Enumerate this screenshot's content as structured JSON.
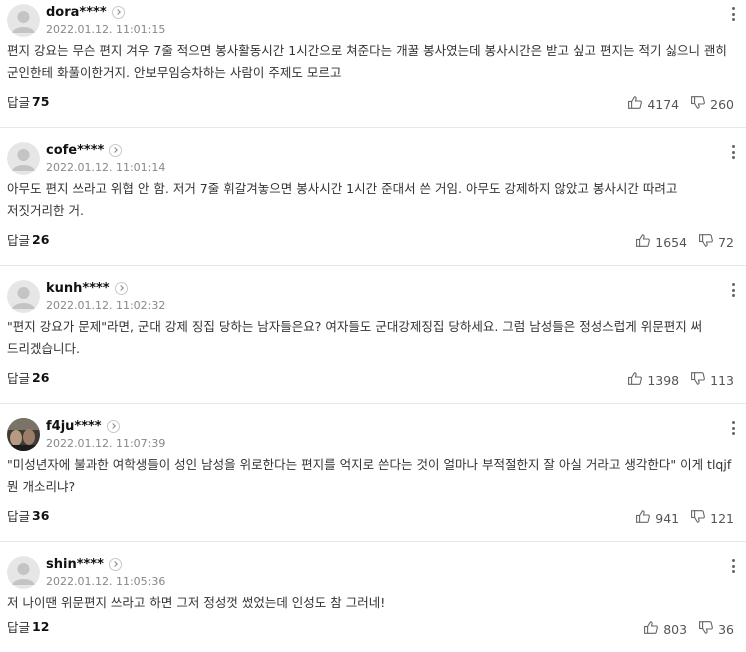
{
  "reply_label": "답글",
  "comments": [
    {
      "nickname": "dora****",
      "date": "2022.01.12. 11:01:15",
      "text": "편지 강요는 무슨 편지 겨우 7줄 적으면 봉사활동시간 1시간으로 쳐준다는 개꿀 봉사였는데 봉사시간은 받고 싶고 편지는 적기 싫으니 괜히 군인한테 화풀이한거지. 안보무임승차하는 사람이 주제도 모르고",
      "replies": "75",
      "likes": "4174",
      "dislikes": "260",
      "avatar": "default"
    },
    {
      "nickname": "cofe****",
      "date": "2022.01.12. 11:01:14",
      "text": "아무도 편지 쓰라고 위협 안 함. 저거 7줄 휘갈겨놓으면 봉사시간 1시간 준대서 쓴 거임. 아무도 강제하지 않았고 봉사시간 따려고 저짓거리한 거.",
      "replies": "26",
      "likes": "1654",
      "dislikes": "72",
      "avatar": "default"
    },
    {
      "nickname": "kunh****",
      "date": "2022.01.12. 11:02:32",
      "text": "\"편지 강요가 문제\"라면, 군대 강제 징집 당하는 남자들은요? 여자들도 군대강제징집 당하세요. 그럼 남성들은 정성스럽게 위문편지 써 드리겠습니다.",
      "replies": "26",
      "likes": "1398",
      "dislikes": "113",
      "avatar": "default"
    },
    {
      "nickname": "f4ju****",
      "date": "2022.01.12. 11:07:39",
      "text": "\"미성년자에 불과한 여학생들이 성인 남성을 위로한다는 편지를 억지로 쓴다는 것이 얼마나 부적절한지 잘 아실 거라고 생각한다\" 이게 tlqjf 뭔 개소리냐?",
      "replies": "36",
      "likes": "941",
      "dislikes": "121",
      "avatar": "photo"
    },
    {
      "nickname": "shin****",
      "date": "2022.01.12. 11:05:36",
      "text": "저 나이땐 위문편지 쓰라고 하면 그저 정성껏 썼었는데 인성도 참 그러네!",
      "replies": "12",
      "likes": "803",
      "dislikes": "36",
      "avatar": "default"
    }
  ]
}
